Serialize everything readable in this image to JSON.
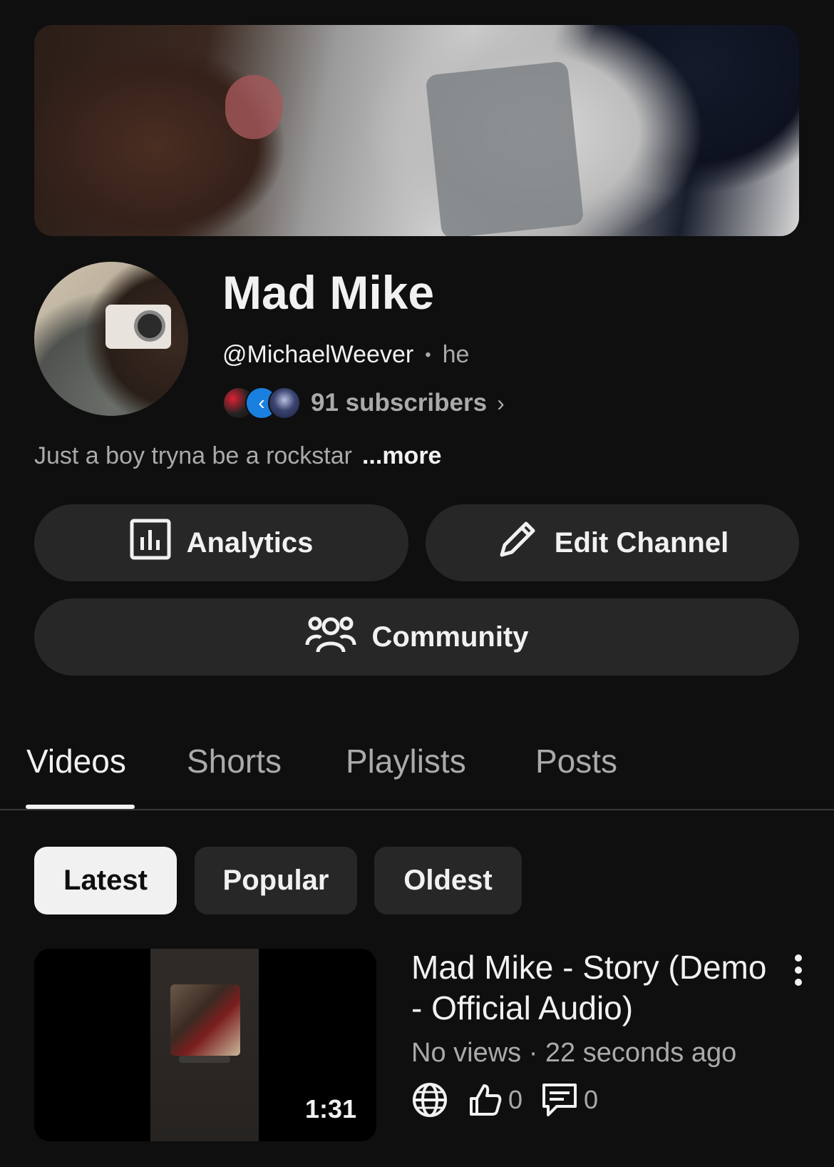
{
  "channel": {
    "name": "Mad Mike",
    "handle": "@MichaelWeever",
    "pronoun": "he",
    "subscribers": "91 subscribers",
    "description": "Just a boy tryna be a rockstar",
    "more_label": "...more"
  },
  "actions": {
    "analytics_label": "Analytics",
    "edit_label": "Edit Channel",
    "community_label": "Community"
  },
  "tabs": [
    {
      "label": "Videos",
      "active": true
    },
    {
      "label": "Shorts",
      "active": false
    },
    {
      "label": "Playlists",
      "active": false
    },
    {
      "label": "Posts",
      "active": false
    }
  ],
  "filters": [
    {
      "label": "Latest",
      "selected": true
    },
    {
      "label": "Popular",
      "selected": false
    },
    {
      "label": "Oldest",
      "selected": false
    }
  ],
  "video": {
    "title": "Mad Mike - Story (Demo - Official Audio)",
    "meta": "No views · 22 seconds ago",
    "duration": "1:31",
    "likes": "0",
    "comments": "0",
    "visibility_icon": "globe-icon"
  },
  "colors": {
    "background": "#0f0f0f",
    "pill": "#272727",
    "text_primary": "#f1f1f1",
    "text_secondary": "#aaaaaa"
  }
}
